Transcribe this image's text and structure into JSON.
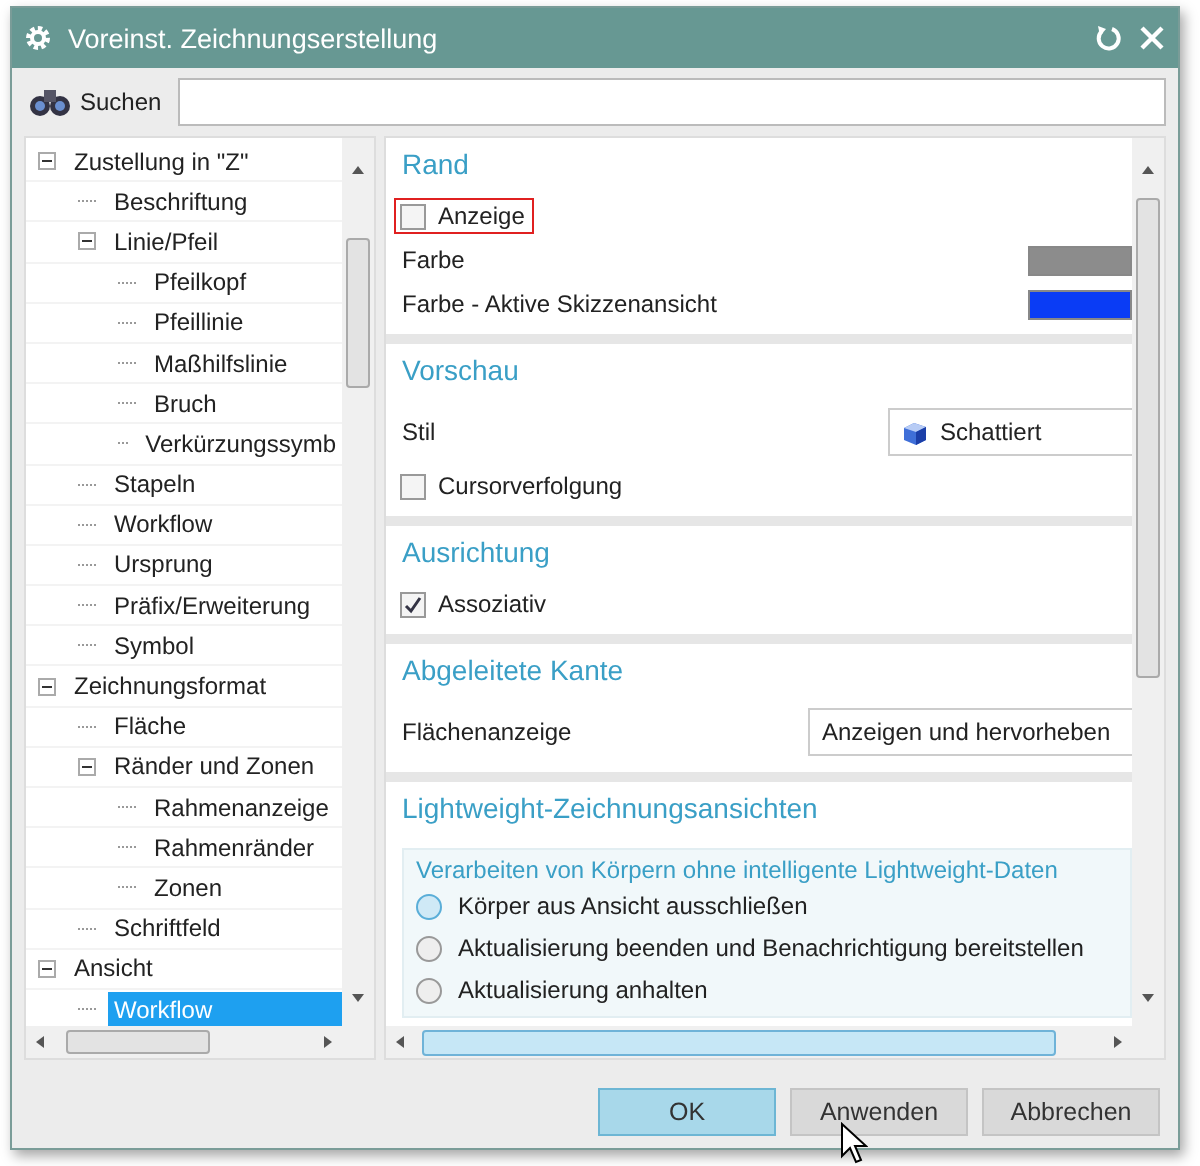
{
  "window": {
    "title": "Voreinst. Zeichnungserstellung"
  },
  "search": {
    "label": "Suchen"
  },
  "tree": [
    {
      "label": "Zustellung in \"Z\"",
      "expanded": true,
      "selected": false,
      "children": [
        {
          "label": "Beschriftung",
          "selected": false
        },
        {
          "label": "Linie/Pfeil",
          "expanded": true,
          "selected": false,
          "children": [
            {
              "label": "Pfeilkopf",
              "selected": false
            },
            {
              "label": "Pfeillinie",
              "selected": false
            },
            {
              "label": "Maßhilfslinie",
              "selected": false
            },
            {
              "label": "Bruch",
              "selected": false
            },
            {
              "label": "Verkürzungssymb",
              "selected": false
            }
          ]
        },
        {
          "label": "Stapeln",
          "selected": false
        },
        {
          "label": "Workflow",
          "selected": false
        },
        {
          "label": "Ursprung",
          "selected": false
        },
        {
          "label": "Präfix/Erweiterung",
          "selected": false
        },
        {
          "label": "Symbol",
          "selected": false
        }
      ]
    },
    {
      "label": "Zeichnungsformat",
      "expanded": true,
      "selected": false,
      "children": [
        {
          "label": "Fläche",
          "selected": false
        },
        {
          "label": "Ränder und Zonen",
          "expanded": true,
          "selected": false,
          "children": [
            {
              "label": "Rahmenanzeige",
              "selected": false
            },
            {
              "label": "Rahmenränder",
              "selected": false
            },
            {
              "label": "Zonen",
              "selected": false
            }
          ]
        },
        {
          "label": "Schriftfeld",
          "selected": false
        }
      ]
    },
    {
      "label": "Ansicht",
      "expanded": true,
      "selected": false,
      "children": [
        {
          "label": "Workflow",
          "selected": true
        }
      ]
    }
  ],
  "sections": [
    {
      "title": "Rand",
      "rows": [
        {
          "kind": "checkbox",
          "label": "Anzeige",
          "checked": false,
          "highlighted": true
        },
        {
          "kind": "color",
          "label": "Farbe",
          "color": "#8c8c8c"
        },
        {
          "kind": "color",
          "label": "Farbe - Aktive Skizzenansicht",
          "color": "#0a3cf5"
        }
      ]
    },
    {
      "title": "Vorschau",
      "rows": [
        {
          "kind": "select",
          "label": "Stil",
          "value": "Schattiert",
          "icon": true
        },
        {
          "kind": "checkbox",
          "label": "Cursorverfolgung",
          "checked": false,
          "highlighted": false
        }
      ]
    },
    {
      "title": "Ausrichtung",
      "rows": [
        {
          "kind": "checkbox",
          "label": "Assoziativ",
          "checked": true,
          "highlighted": false
        }
      ]
    },
    {
      "title": "Abgeleitete Kante",
      "rows": [
        {
          "kind": "select",
          "label": "Flächenanzeige",
          "value": "Anzeigen und hervorheben",
          "icon": false
        }
      ]
    },
    {
      "title": "Lightweight-Zeichnungsansichten",
      "rows": [
        {
          "kind": "group",
          "title": "Verarbeiten von Körpern ohne intelligente Lightweight-Daten",
          "options": [
            {
              "label": "Körper aus Ansicht ausschließen",
              "selected": false,
              "hovered": true
            },
            {
              "label": "Aktualisierung beenden und Benachrichtigung bereitstellen",
              "selected": false,
              "hovered": false
            },
            {
              "label": "Aktualisierung anhalten",
              "selected": false,
              "hovered": false
            }
          ]
        }
      ]
    }
  ],
  "buttons": [
    {
      "label": "OK",
      "default": true
    },
    {
      "label": "Anwenden",
      "default": false
    },
    {
      "label": "Abbrechen",
      "default": false
    }
  ]
}
